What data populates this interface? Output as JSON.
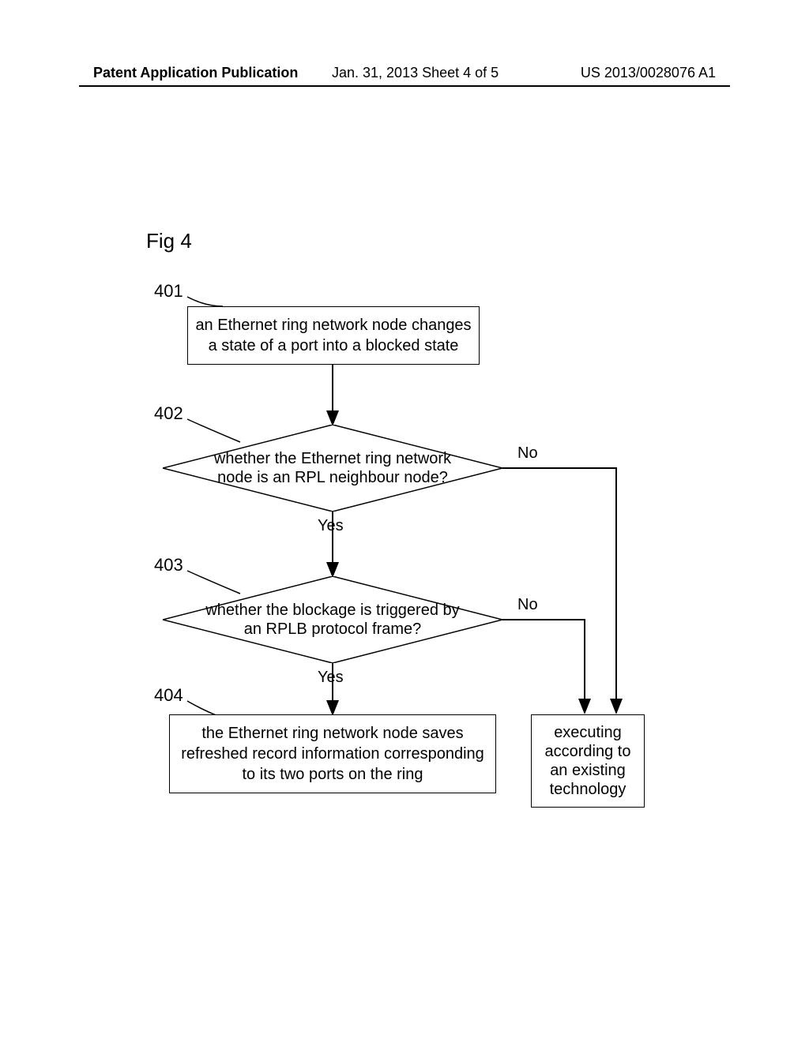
{
  "header": {
    "left": "Patent Application Publication",
    "center": "Jan. 31, 2013  Sheet 4 of 5",
    "right": "US 2013/0028076 A1"
  },
  "fig_label": "Fig 4",
  "steps": {
    "s401": {
      "num": "401",
      "text": "an Ethernet ring network node changes a state of a port into a blocked state"
    },
    "s402": {
      "num": "402",
      "text": "whether the Ethernet ring network node is an RPL neighbour node?",
      "yes": "Yes",
      "no": "No"
    },
    "s403": {
      "num": "403",
      "text": "whether the blockage is triggered by an RPLB protocol frame?",
      "yes": "Yes",
      "no": "No"
    },
    "s404": {
      "num": "404",
      "text": "the Ethernet ring network node saves refreshed record information corresponding to its two ports on the ring"
    },
    "alt": {
      "text": "executing according to an existing technology"
    }
  },
  "chart_data": {
    "type": "flowchart",
    "title": "Fig 4",
    "nodes": [
      {
        "id": "401",
        "shape": "rect",
        "label": "an Ethernet ring network node changes a state of a port into a blocked state"
      },
      {
        "id": "402",
        "shape": "diamond",
        "label": "whether the Ethernet ring network node is an RPL neighbour node?"
      },
      {
        "id": "403",
        "shape": "diamond",
        "label": "whether the blockage is triggered by an RPLB protocol frame?"
      },
      {
        "id": "404",
        "shape": "rect",
        "label": "the Ethernet ring network node saves refreshed record information corresponding to its two ports on the ring"
      },
      {
        "id": "ALT",
        "shape": "rect",
        "label": "executing according to an existing technology"
      }
    ],
    "edges": [
      {
        "from": "401",
        "to": "402",
        "label": ""
      },
      {
        "from": "402",
        "to": "403",
        "label": "Yes"
      },
      {
        "from": "402",
        "to": "ALT",
        "label": "No"
      },
      {
        "from": "403",
        "to": "404",
        "label": "Yes"
      },
      {
        "from": "403",
        "to": "ALT",
        "label": "No"
      }
    ]
  }
}
